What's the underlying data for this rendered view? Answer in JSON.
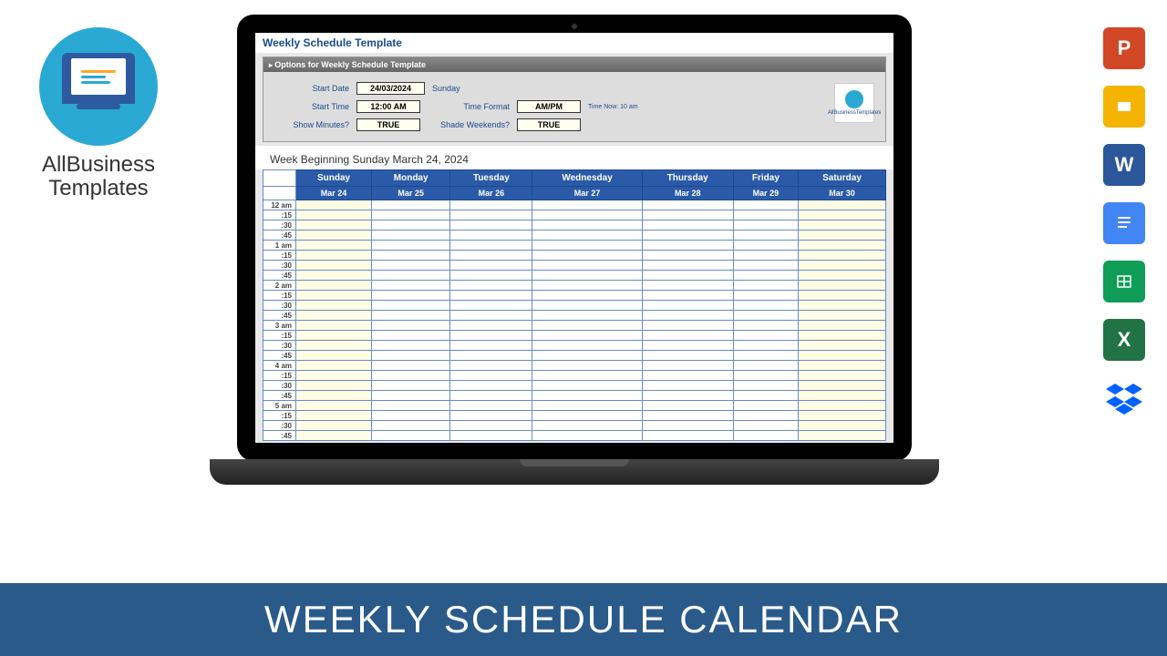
{
  "brand": {
    "line1": "AllBusiness",
    "line2": "Templates"
  },
  "title": "Weekly Schedule Template",
  "optsHeader": "Options for Weekly Schedule Template",
  "opts": {
    "startDateLbl": "Start Date",
    "startDate": "24/03/2024",
    "startDateDay": "Sunday",
    "startTimeLbl": "Start Time",
    "startTime": "12:00 AM",
    "timeFmtLbl": "Time Format",
    "timeFmt": "AM/PM",
    "timeNow": "Time Now: 10 am",
    "showMinLbl": "Show Minutes?",
    "showMin": "TRUE",
    "shadeLbl": "Shade Weekends?",
    "shade": "TRUE"
  },
  "miniLogo": "AllBusinessTemplates",
  "weekTitle": "Week Beginning Sunday March 24, 2024",
  "days": [
    "Sunday",
    "Monday",
    "Tuesday",
    "Wednesday",
    "Thursday",
    "Friday",
    "Saturday"
  ],
  "dates": [
    "Mar 24",
    "Mar 25",
    "Mar 26",
    "Mar 27",
    "Mar 28",
    "Mar 29",
    "Mar 30"
  ],
  "hours": [
    "12 am",
    "1 am",
    "2 am",
    "3 am",
    "4 am",
    "5 am"
  ],
  "mins": [
    ":15",
    ":30",
    ":45"
  ],
  "apps": [
    "PowerPoint",
    "Slides",
    "Word",
    "Docs",
    "Sheets",
    "Excel",
    "Dropbox"
  ],
  "footer": "WEEKLY SCHEDULE CALENDAR"
}
